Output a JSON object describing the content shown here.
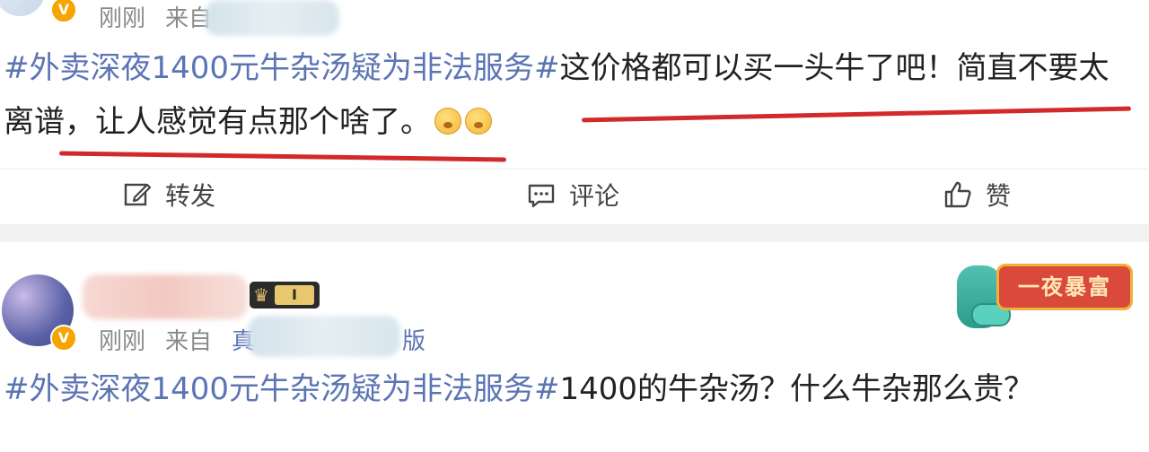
{
  "post1": {
    "time": "刚刚",
    "source_prefix": "来自",
    "hashtag": "#外卖深夜1400元牛杂汤疑为非法服务#",
    "line1_rest": "这价格都可以买一头牛了吧！简直不要太",
    "line2": "离谱，让人感觉有点那个啥了。",
    "verified_badge": "V"
  },
  "actions": {
    "repost": "转发",
    "comment": "评论",
    "like": "赞",
    "icons": [
      "edit-icon",
      "comment-icon",
      "thumbs-up-icon"
    ]
  },
  "post2": {
    "time": "刚刚",
    "source_prefix": "来自",
    "source_visible_start": "真",
    "source_visible_end": "版",
    "hashtag": "#外卖深夜1400元牛杂汤疑为非法服务#",
    "content": "1400的牛杂汤？什么牛杂那么贵？",
    "rank_level": "I",
    "decoration_text": "一夜暴富",
    "verified_badge": "V"
  },
  "colors": {
    "hashtag": "#5b74b4",
    "underline": "#d22a2a",
    "meta": "#8a8a8a"
  }
}
